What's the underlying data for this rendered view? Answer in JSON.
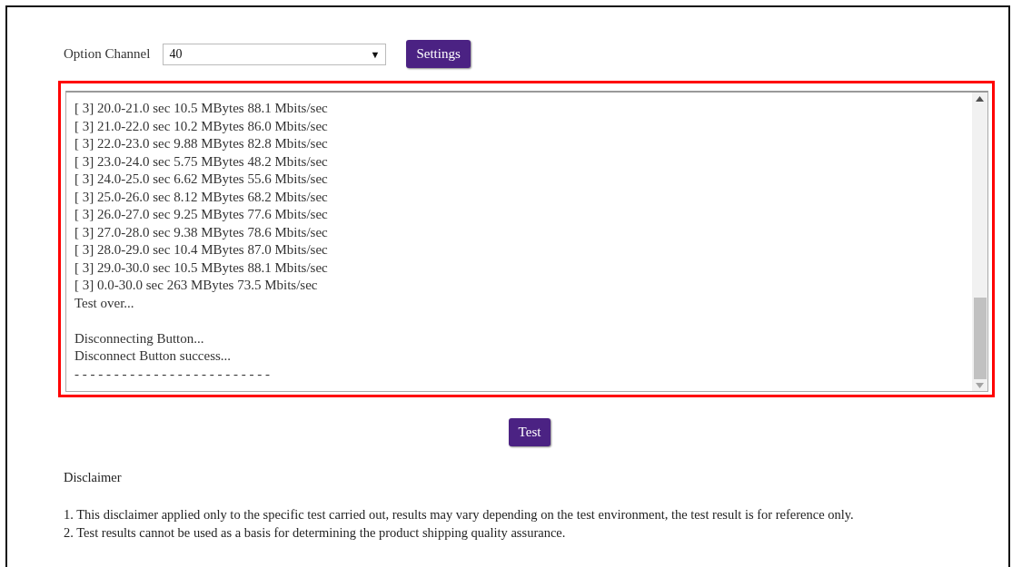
{
  "option_channel": {
    "label": "Option Channel",
    "value": "40",
    "arrow": "▼"
  },
  "settings_button": "Settings",
  "log": {
    "lines": [
      {
        "kind": "text",
        "text": "[ 3] 20.0-21.0 sec 10.5 MBytes 88.1 Mbits/sec"
      },
      {
        "kind": "text",
        "text": "[ 3] 21.0-22.0 sec 10.2 MBytes 86.0 Mbits/sec"
      },
      {
        "kind": "text",
        "text": "[ 3] 22.0-23.0 sec 9.88 MBytes 82.8 Mbits/sec"
      },
      {
        "kind": "text",
        "text": "[ 3] 23.0-24.0 sec 5.75 MBytes 48.2 Mbits/sec"
      },
      {
        "kind": "text",
        "text": "[ 3] 24.0-25.0 sec 6.62 MBytes 55.6 Mbits/sec"
      },
      {
        "kind": "text",
        "text": "[ 3] 25.0-26.0 sec 8.12 MBytes 68.2 Mbits/sec"
      },
      {
        "kind": "text",
        "text": "[ 3] 26.0-27.0 sec 9.25 MBytes 77.6 Mbits/sec"
      },
      {
        "kind": "text",
        "text": "[ 3] 27.0-28.0 sec 9.38 MBytes 78.6 Mbits/sec"
      },
      {
        "kind": "text",
        "text": "[ 3] 28.0-29.0 sec 10.4 MBytes 87.0 Mbits/sec"
      },
      {
        "kind": "text",
        "text": "[ 3] 29.0-30.0 sec 10.5 MBytes 88.1 Mbits/sec"
      },
      {
        "kind": "text",
        "text": "[ 3] 0.0-30.0 sec 263 MBytes 73.5 Mbits/sec"
      },
      {
        "kind": "text",
        "text": "Test over..."
      },
      {
        "kind": "blank"
      },
      {
        "kind": "text",
        "text": "Disconnecting Button..."
      },
      {
        "kind": "text",
        "text": "Disconnect Button success..."
      },
      {
        "kind": "text",
        "text": "- - - - - - - - - - - - - - - - - - - - - - - - -"
      }
    ]
  },
  "test_button": "Test",
  "disclaimer": {
    "title": "Disclaimer",
    "items": [
      "1. This disclaimer applied only to the specific test carried out, results may vary depending on the test environment, the test result is for reference only.",
      "2. Test results cannot be used as a basis for determining the product shipping quality assurance."
    ]
  }
}
